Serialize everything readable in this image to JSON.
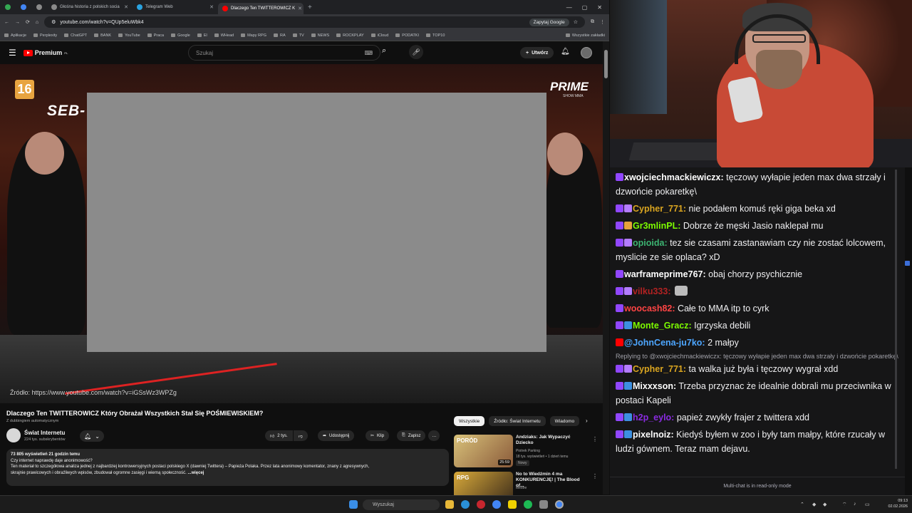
{
  "browser": {
    "tabs": [
      {
        "label": "",
        "color": "#34a853"
      },
      {
        "label": "",
        "color": "#4285f4"
      },
      {
        "label": "",
        "color": "#8a8a8a"
      },
      {
        "label": "Głośna historia z polskich socia",
        "color": "#8a8a8a"
      },
      {
        "label": "Telegram Web",
        "color": "#2aa3e0"
      },
      {
        "label": "Dlaczego Ten TWITTEROWICZ K",
        "color": "#ff0000",
        "active": true
      }
    ],
    "url": "youtube.com/watch?v=QUp5eluWbk4",
    "ask_google": "Zapytaj Google",
    "bookmarks": [
      "Aplikacje",
      "Perplexity",
      "ChatGPT",
      "BANK",
      "YouTube",
      "Praca",
      "Google",
      "El",
      "WHead",
      "Mapy RPG",
      "RA",
      "TV",
      "NEWS",
      "ROCKPLAY",
      "iCloud",
      "PODATKI",
      "TOP10"
    ],
    "bookmarks_right": "Wszystkie zakładki"
  },
  "youtube": {
    "logo": "Premium",
    "logo_sup": "PL",
    "search_placeholder": "Szukaj",
    "create_label": "Utwórz",
    "video": {
      "age_badge": "16",
      "overlay_name": "SEB-",
      "brand": "PRIME",
      "brand_sub": "SHOW MMA",
      "source_label": "Źródło:",
      "source_url": "https://www.youtube.com/watch?v=iGSsWz3WPZg"
    },
    "title": "Dlaczego Ten TWITTEROWICZ Który Obrażał Wszystkich Stał Się POŚMIEWISKIEM?",
    "dubbing": "Z dubbingiem automatycznym",
    "channel": {
      "name": "Świat Internetu",
      "subs": "224 tys. subskrybentów"
    },
    "actions": {
      "likes": "2 tys.",
      "share": "Udostępnij",
      "clip": "Klip",
      "save": "Zapisz"
    },
    "description": {
      "stats": "73 805 wyświetleń  21 godzin temu",
      "line1": "Czy internet naprawdę daje anonimowość?",
      "line2": "Ten materiał to szczegółowa analiza jednej z najbardziej kontrowersyjnych postaci polskiego X (dawniej Twittera) – Papieża Polaka. Przez lata anonimowy komentator, znany z agresywnych,",
      "line3": "skrajnie prawicowych i obraźliwych wpisów, zbudował ogromne zasięgi i wierną społeczność.",
      "more": "...więcej"
    },
    "chips": [
      "Wszystkie",
      "Źródło: Świat Internetu",
      "Wiadomo"
    ],
    "recs": [
      {
        "title": "Andziaks: Jak Wypaczyć Dziecko",
        "channel": "Piotrek Parking",
        "meta": "18 tys. wyświetleń • 1 dzień temu",
        "badge": "Nowy",
        "duration": "25:59",
        "thumb_text": "PORÓD"
      },
      {
        "title": "No to Wiedźmin 4 ma KONKURENCJĘ! | The Blood of...",
        "channel": "Mestre",
        "meta": "",
        "badge": "",
        "duration": "",
        "thumb_text": "RPG"
      }
    ]
  },
  "chat": {
    "messages": [
      {
        "user": "xwojciechmackiewiczx:",
        "text": " tęczowy wyłapie jeden max dwa strzały i dzwońcie pokaretkę\\",
        "color": "#ffffff",
        "badges": [
          "#9147ff"
        ]
      },
      {
        "user": "Cypher_771:",
        "text": " nie podałem komuś ręki giga beka xd",
        "color": "#daa520",
        "badges": [
          "#9147ff",
          "#b47cff"
        ]
      },
      {
        "user": "Gr3mlinPL:",
        "text": " Dobrze że męski Jasio naklepał mu",
        "color": "#7cfc00",
        "badges": [
          "#9147ff",
          "#e6a23c"
        ]
      },
      {
        "user": "opioida:",
        "text": " tez sie czasami zastanawiam czy nie zostać lolcowem, myslicie ze sie oplaca? xD",
        "color": "#3cb371",
        "badges": [
          "#9147ff",
          "#b47cff"
        ]
      },
      {
        "user": "warframeprime767:",
        "text": " obaj chorzy psychicznie",
        "color": "#ffffff",
        "badges": [
          "#9147ff"
        ]
      },
      {
        "user": "vilku333:",
        "text": " ",
        "color": "#b22222",
        "badges": [
          "#9147ff",
          "#b47cff"
        ],
        "emote": true
      },
      {
        "user": "woocash82:",
        "text": " Całe to MMA itp to cyrk",
        "color": "#ff4444",
        "badges": [
          "#9147ff"
        ]
      },
      {
        "user": "Monte_Gracz:",
        "text": " Igrzyska debili",
        "color": "#7cfc00",
        "badges": [
          "#9147ff",
          "#3d8fe0"
        ]
      },
      {
        "user": "@JohnCena-ju7ko:",
        "text": " 2 małpy",
        "color": "#4da6ff",
        "badges": [
          "#ff0000"
        ]
      },
      {
        "reply": "Replying to @xwojciechmackiewiczx: tęczowy wyłapie jeden max dwa strzały i dzwońcie pokaretkę\\"
      },
      {
        "user": "Cypher_771:",
        "text": "  ta walka już była i tęczowy wygrał xdd",
        "color": "#daa520",
        "badges": [
          "#9147ff",
          "#b47cff"
        ]
      },
      {
        "user": "Mixxxson:",
        "text": " Trzeba przyznac że idealnie dobrali mu przeciwnika w postaci Kapeli",
        "color": "#ffffff",
        "badges": [
          "#9147ff",
          "#3d8fe0"
        ]
      },
      {
        "user": "h2p_eylo:",
        "text": " papież zwykły frajer z twittera xdd",
        "color": "#8a2be2",
        "badges": [
          "#9147ff",
          "#3d8fe0"
        ]
      },
      {
        "user": "pixelnoiz:",
        "text": " Kiedyś byłem w zoo i były tam małpy, które rzucały w ludzi gównem. Teraz mam dejavu.",
        "color": "#ffffff",
        "badges": [
          "#9147ff",
          "#3d8fe0"
        ]
      }
    ],
    "readonly": "Multi-chat is in read-only mode"
  },
  "taskbar": {
    "search": "Wyszukaj",
    "time": "09:13",
    "date": "02.02.2026"
  }
}
